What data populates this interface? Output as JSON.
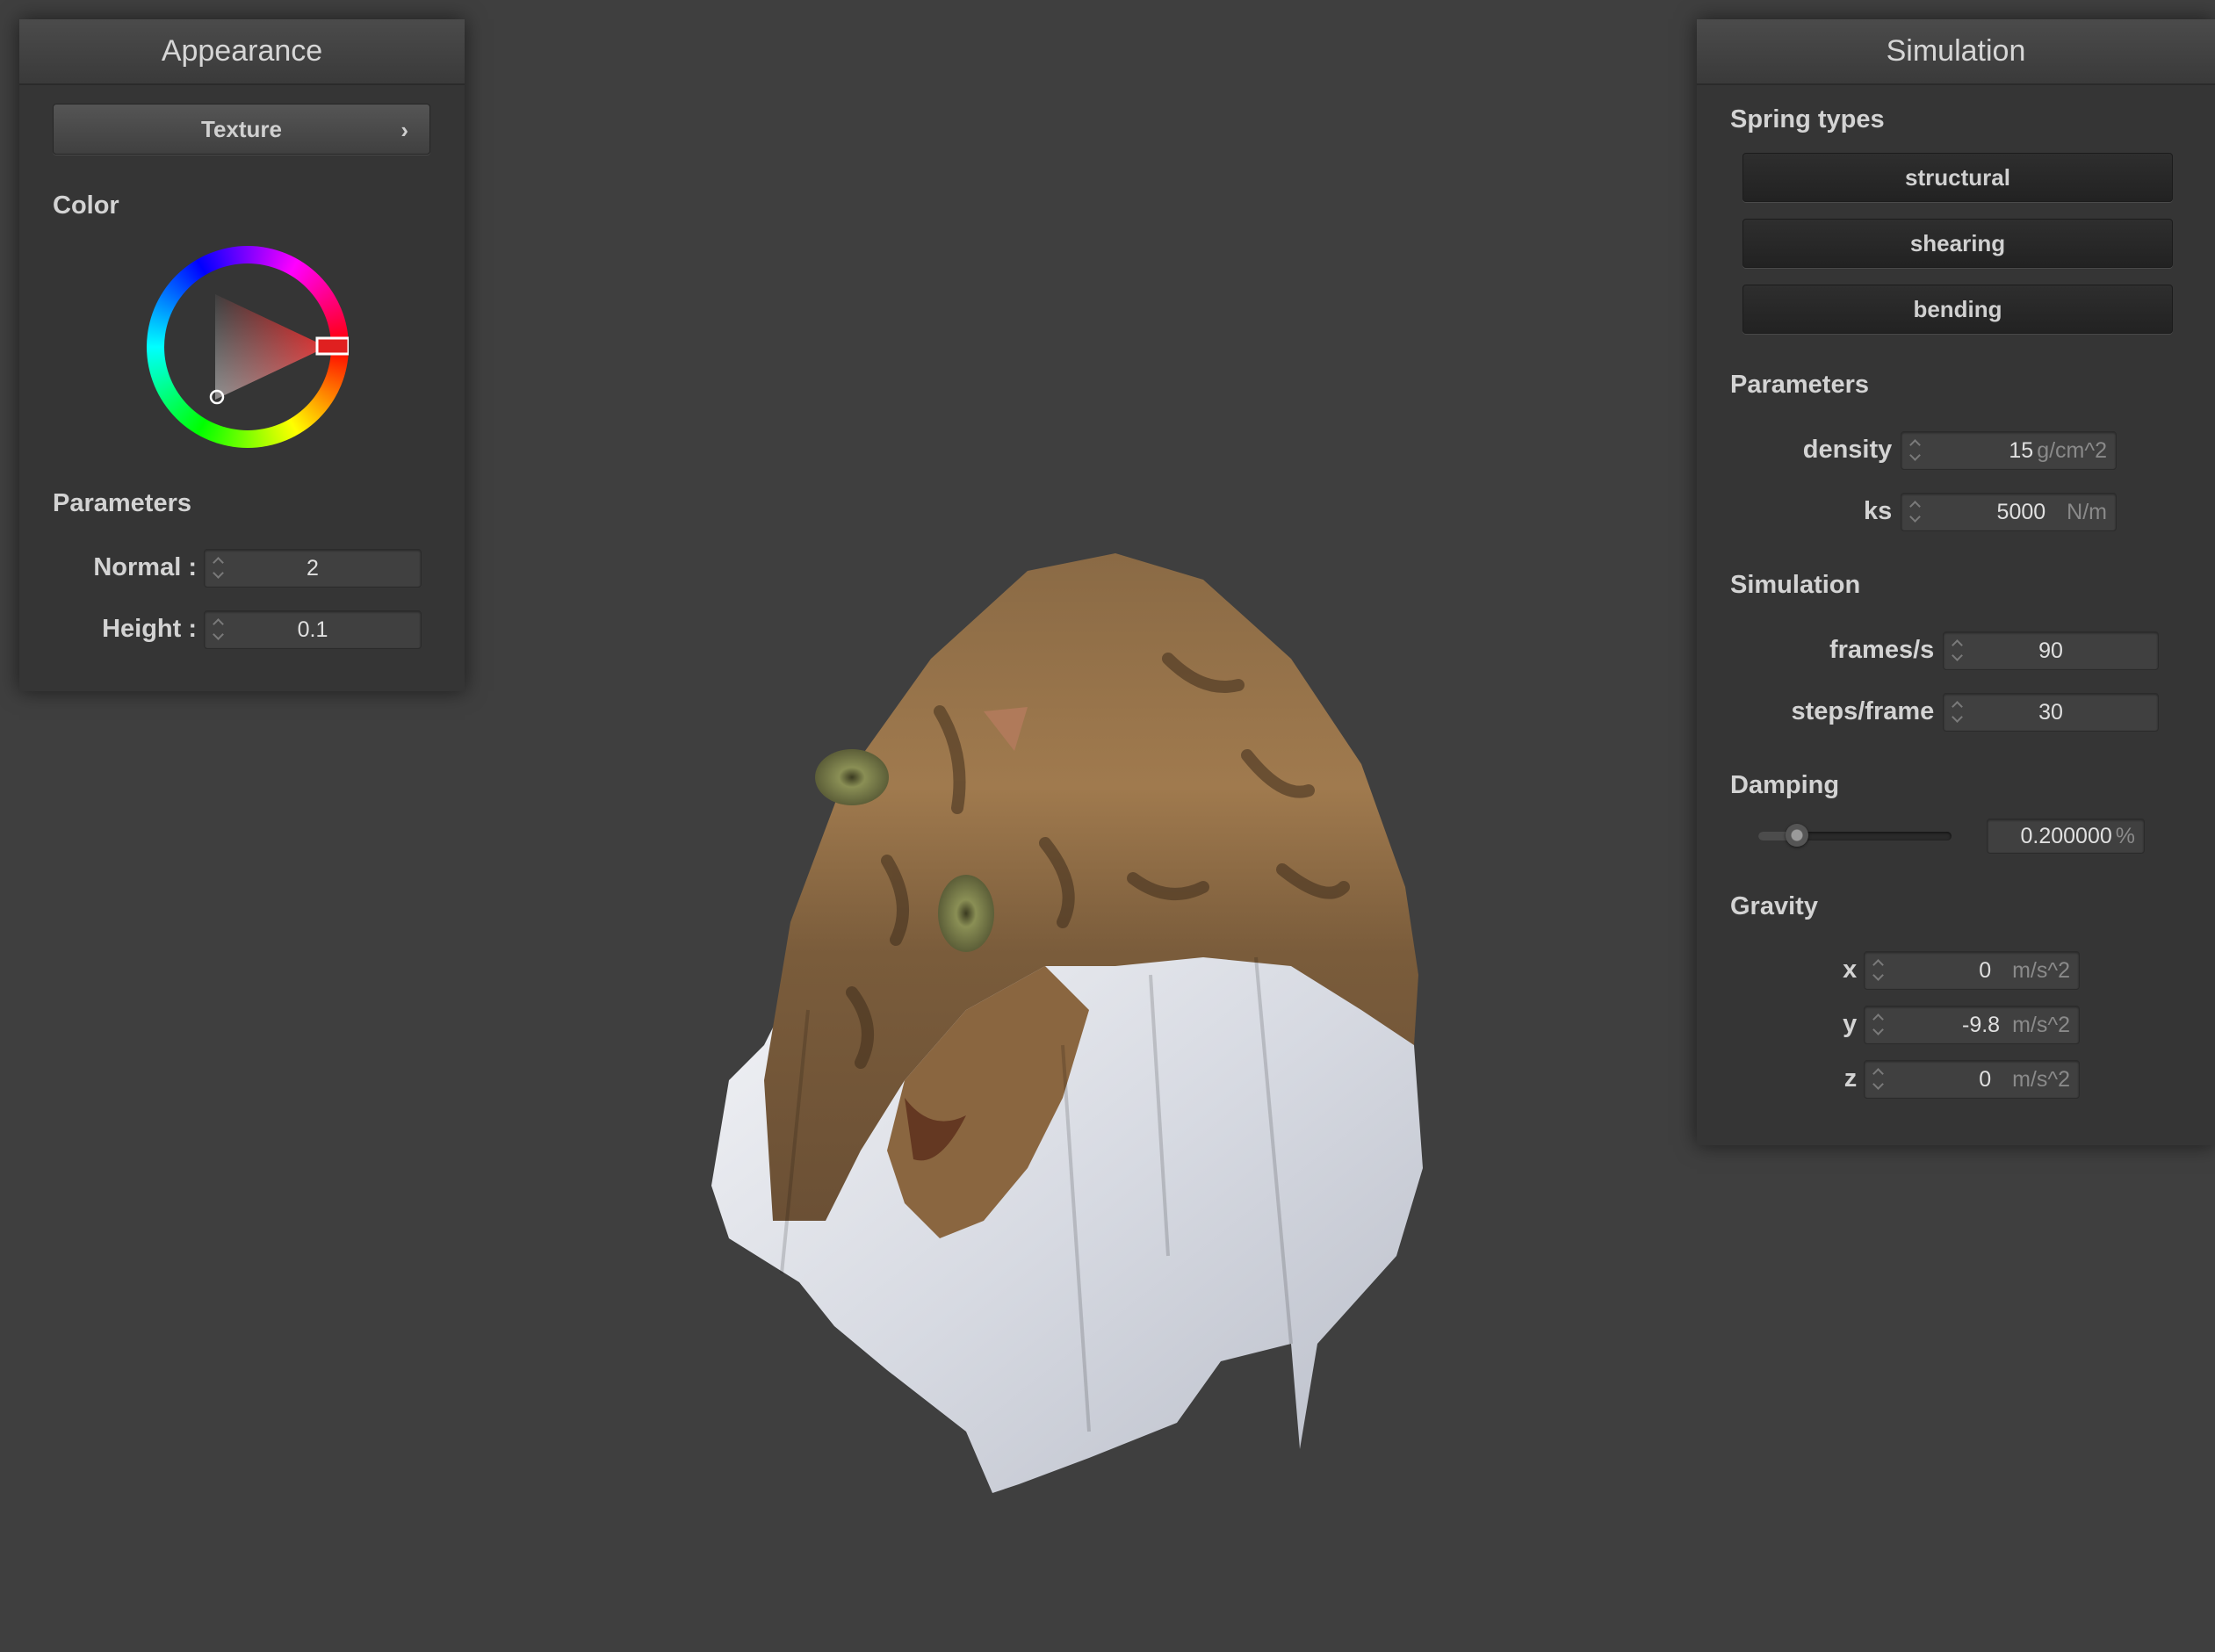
{
  "appearance": {
    "title": "Appearance",
    "texture_button": "Texture",
    "chevron": "›",
    "color_label": "Color",
    "selected_color": "#e02020",
    "parameters_label": "Parameters",
    "normal_label": "Normal :",
    "normal_value": "2",
    "height_label": "Height :",
    "height_value": "0.1"
  },
  "simulation": {
    "title": "Simulation",
    "spring_types_label": "Spring types",
    "spring_buttons": [
      "structural",
      "shearing",
      "bending"
    ],
    "parameters_label": "Parameters",
    "density_label": "density :",
    "density_value": "15",
    "density_unit": "g/cm^2",
    "ks_label": "ks :",
    "ks_value": "5000",
    "ks_unit": "N/m",
    "simulation_label": "Simulation",
    "fps_label": "frames/s :",
    "fps_value": "90",
    "steps_label": "steps/frame :",
    "steps_value": "30",
    "damping_label": "Damping",
    "damping_fraction": 0.2,
    "damping_value": "0.200000",
    "damping_unit": "%",
    "gravity_label": "Gravity",
    "gx_label": "x :",
    "gx_value": "0",
    "gy_label": "y :",
    "gy_value": "-9.8",
    "gz_label": "z :",
    "gz_value": "0",
    "gravity_unit": "m/s^2"
  }
}
